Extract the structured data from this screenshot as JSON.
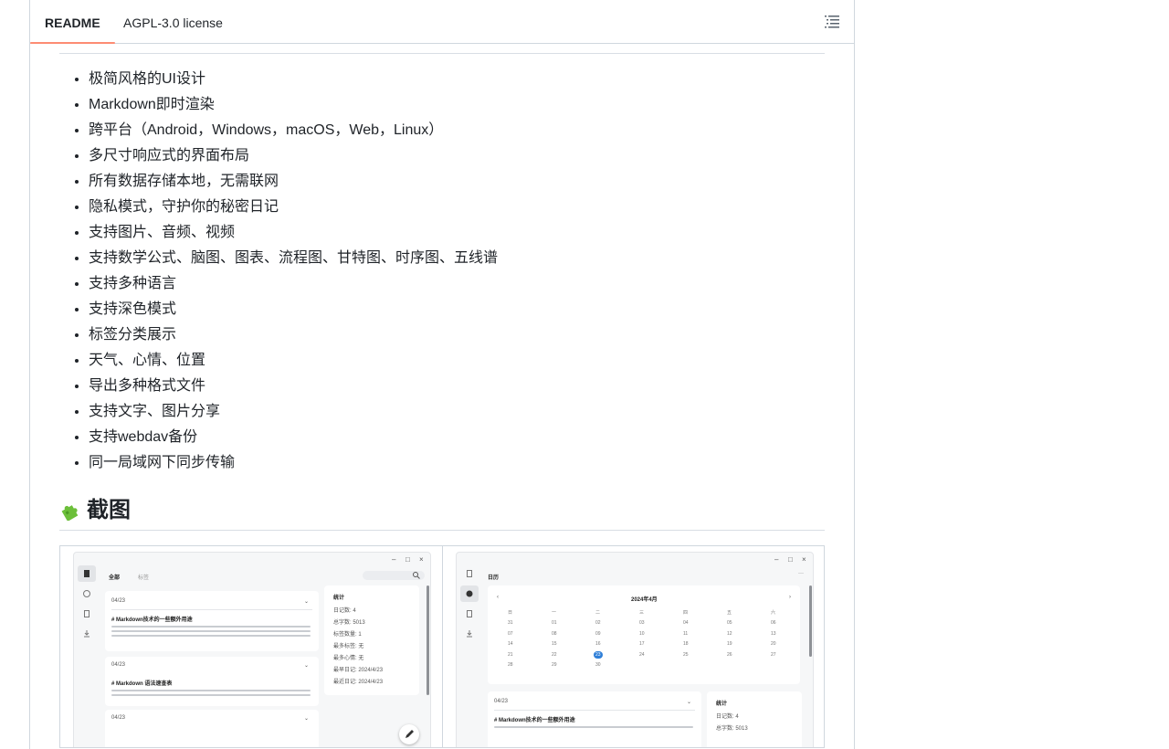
{
  "tabs": {
    "readme": "README",
    "license": "AGPL-3.0 license"
  },
  "features": [
    "极简风格的UI设计",
    "Markdown即时渲染",
    "跨平台（Android，Windows，macOS，Web，Linux）",
    "多尺寸响应式的界面布局",
    "所有数据存储本地，无需联网",
    "隐私模式，守护你的秘密日记",
    "支持图片、音频、视频",
    "支持数学公式、脑图、图表、流程图、甘特图、时序图、五线谱",
    "支持多种语言",
    "支持深色模式",
    "标签分类展示",
    "天气、心情、位置",
    "导出多种格式文件",
    "支持文字、图片分享",
    "支持webdav备份",
    "同一局域网下同步传输"
  ],
  "screenshots_heading": "截图",
  "icons": {
    "outline": "list-outline-icon",
    "heading_emoji": "puzzle-piece-icon"
  },
  "shot_left": {
    "tab_all": "全部",
    "tab_tag": "标签",
    "date1": "04/23",
    "title1": "# Markdown技术的一些额外用途",
    "date2": "04/23",
    "title2": "# Markdown 语法速查表",
    "date3": "04/23",
    "stats_title": "统计",
    "stats": [
      "日记数: 4",
      "总字数: 5013",
      "标签数量: 1",
      "最多标签: 无",
      "最多心情: 无",
      "最早日记: 2024/4/23",
      "最近日记: 2024/4/23"
    ]
  },
  "shot_right": {
    "title": "日历",
    "month": "2024年4月",
    "weekdays": [
      "日",
      "一",
      "二",
      "三",
      "四",
      "五",
      "六"
    ],
    "days": [
      "31",
      "01",
      "02",
      "03",
      "04",
      "05",
      "06",
      "07",
      "08",
      "09",
      "10",
      "11",
      "12",
      "13",
      "14",
      "15",
      "16",
      "17",
      "18",
      "19",
      "20",
      "21",
      "22",
      "23",
      "24",
      "25",
      "26",
      "27",
      "28",
      "29",
      "30"
    ],
    "selected_day": "23",
    "date1": "04/23",
    "title1": "# Markdown技术的一些额外用途",
    "stats_title": "统计",
    "stats": [
      "日记数: 4",
      "总字数: 5013"
    ]
  },
  "colors": {
    "accent_tab": "#fd8c73",
    "selected_day": "#2f7fd8"
  }
}
